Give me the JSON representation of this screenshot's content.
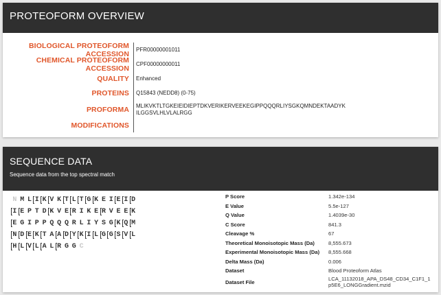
{
  "overview": {
    "title": "PROTEOFORM OVERVIEW",
    "rows": [
      {
        "label": "BIOLOGICAL PROTEOFORM ACCESSION",
        "value": "PFR00000001011"
      },
      {
        "label": "CHEMICAL PROTEOFORM ACCESSION",
        "value": "CPF00000000011"
      },
      {
        "label": "QUALITY",
        "value": "Enhanced"
      },
      {
        "label": "PROTEINS",
        "value": "Q15843 (NEDD8) (0-75)"
      },
      {
        "label": "PROFORMA",
        "value": "MLIKVKTLTGKEIEIDIEPTDKVERIKERVEEKEGIPPQQQRLIYSGKQMNDEKTAADYK ILGGSVLHLVLALRGG"
      },
      {
        "label": "MODIFICATIONS",
        "value": ""
      }
    ]
  },
  "sequence": {
    "title": "SEQUENCE DATA",
    "subtitle": "Sequence data from the top spectral match",
    "residues": [
      [
        {
          "aa": "N",
          "faded": true
        },
        {
          "aa": "M"
        },
        {
          "aa": "L"
        },
        {
          "aa": "I",
          "cl": true
        },
        {
          "aa": "K",
          "cl": true
        },
        {
          "aa": "V",
          "cl": true
        },
        {
          "aa": "K"
        },
        {
          "aa": "T",
          "cl": true
        },
        {
          "aa": "L",
          "cl": true
        },
        {
          "aa": "T",
          "cl": true
        },
        {
          "aa": "G",
          "cl": true
        },
        {
          "aa": "K",
          "cl": true
        },
        {
          "aa": "E"
        },
        {
          "aa": "I"
        },
        {
          "aa": "E",
          "cl": true
        },
        {
          "aa": "I",
          "cl": true
        },
        {
          "aa": "D",
          "cl": true
        }
      ],
      [
        {
          "aa": "I",
          "cl": true
        },
        {
          "aa": "E",
          "cl": true
        },
        {
          "aa": "P"
        },
        {
          "aa": "T"
        },
        {
          "aa": "D"
        },
        {
          "aa": "K",
          "cl": true
        },
        {
          "aa": "V"
        },
        {
          "aa": "E"
        },
        {
          "aa": "R",
          "cl": true
        },
        {
          "aa": "I"
        },
        {
          "aa": "K"
        },
        {
          "aa": "E"
        },
        {
          "aa": "R",
          "cl": true
        },
        {
          "aa": "V"
        },
        {
          "aa": "E"
        },
        {
          "aa": "E"
        },
        {
          "aa": "K",
          "cl": true
        }
      ],
      [
        {
          "aa": "E",
          "cl": true
        },
        {
          "aa": "G"
        },
        {
          "aa": "I"
        },
        {
          "aa": "P"
        },
        {
          "aa": "P"
        },
        {
          "aa": "Q"
        },
        {
          "aa": "Q"
        },
        {
          "aa": "Q"
        },
        {
          "aa": "R"
        },
        {
          "aa": "L"
        },
        {
          "aa": "I"
        },
        {
          "aa": "Y"
        },
        {
          "aa": "S"
        },
        {
          "aa": "G"
        },
        {
          "aa": "K",
          "cl": true
        },
        {
          "aa": "Q",
          "cl": true
        },
        {
          "aa": "M",
          "cl": true
        }
      ],
      [
        {
          "aa": "N",
          "cl": true
        },
        {
          "aa": "D",
          "cl": true
        },
        {
          "aa": "E",
          "cl": true
        },
        {
          "aa": "K",
          "cl": true
        },
        {
          "aa": "T",
          "cl": true
        },
        {
          "aa": "A"
        },
        {
          "aa": "A",
          "cl": true
        },
        {
          "aa": "D",
          "cl": true
        },
        {
          "aa": "Y",
          "cl": true
        },
        {
          "aa": "K",
          "cl": true
        },
        {
          "aa": "I",
          "cl": true
        },
        {
          "aa": "L",
          "cl": true
        },
        {
          "aa": "G",
          "cl": true
        },
        {
          "aa": "G",
          "cl": true
        },
        {
          "aa": "S",
          "cl": true
        },
        {
          "aa": "V",
          "cl": true
        },
        {
          "aa": "L",
          "cl": true
        }
      ],
      [
        {
          "aa": "H",
          "cl": true
        },
        {
          "aa": "L",
          "cl": true
        },
        {
          "aa": "V",
          "cl": true
        },
        {
          "aa": "L",
          "cl": true
        },
        {
          "aa": "A",
          "cl": true
        },
        {
          "aa": "L"
        },
        {
          "aa": "R",
          "cl": true
        },
        {
          "aa": "G"
        },
        {
          "aa": "G"
        },
        {
          "aa": "C",
          "faded": true
        }
      ]
    ],
    "stats": [
      {
        "k": "P Score",
        "v": "1.342e-134"
      },
      {
        "k": "E Value",
        "v": "5.5e-127"
      },
      {
        "k": "Q Value",
        "v": "1.4039e-30"
      },
      {
        "k": "C Score",
        "v": "841.3"
      },
      {
        "k": "Cleavage %",
        "v": "67"
      },
      {
        "k": "Theoretical Monoisotopic Mass (Da)",
        "v": "8,555.673"
      },
      {
        "k": "Experimental Monoisotopic Mass (Da)",
        "v": "8,555.668"
      },
      {
        "k": "Delta Mass (Da)",
        "v": "0.006"
      },
      {
        "k": "Dataset",
        "v": "Blood Proteoform Atlas"
      },
      {
        "k": "Dataset File",
        "v": "LCA_11132018_APA_DS48_CD34_C1F1_1 p5E6_LONGGradient.mzid"
      }
    ]
  },
  "colors": {
    "label_accent": "#e0562a",
    "header_bg": "#2f2f2f"
  }
}
